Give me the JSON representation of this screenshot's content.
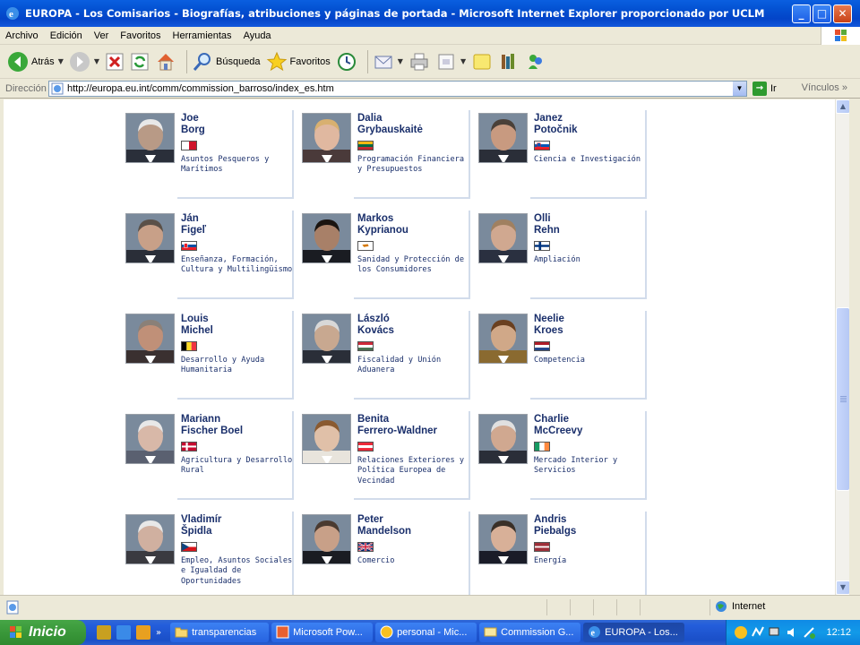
{
  "window": {
    "title": "EUROPA - Los Comisarios - Biografías, atribuciones y páginas de portada - Microsoft Internet Explorer proporcionado por UCLM",
    "minimize": "_",
    "maximize": "□",
    "close": "✕"
  },
  "menu": [
    "Archivo",
    "Edición",
    "Ver",
    "Favoritos",
    "Herramientas",
    "Ayuda"
  ],
  "toolbar": {
    "back": "Atrás",
    "search": "Búsqueda",
    "favorites": "Favoritos"
  },
  "address": {
    "label": "Dirección",
    "url": "http://europa.eu.int/comm/commission_barroso/index_es.htm",
    "go": "Ir",
    "links": "Vínculos"
  },
  "commissioners": [
    {
      "first": "Joe",
      "last": "Borg",
      "portfolio": "Asuntos Pesqueros y Marítimos",
      "flag": "malta",
      "skin": "#b89a86",
      "hair": "#e8e8e8",
      "suit": "#2a2f3a"
    },
    {
      "first": "Dalia",
      "last": "Grybauskaitė",
      "portfolio": "Programación Financiera y Presupuestos",
      "flag": "lithuania",
      "skin": "#e0b8a0",
      "hair": "#d8b070",
      "suit": "#4a3a3a"
    },
    {
      "first": "Janez",
      "last": "Potočnik",
      "portfolio": "Ciencia e Investigación",
      "flag": "slovenia",
      "skin": "#c89a80",
      "hair": "#4a4038",
      "suit": "#2a2e38"
    },
    {
      "first": "Ján",
      "last": "Figeľ",
      "portfolio": "Enseñanza, Formación, Cultura y Multilingüismo",
      "flag": "slovakia",
      "skin": "#c8a088",
      "hair": "#5a5048",
      "suit": "#2a2e38"
    },
    {
      "first": "Markos",
      "last": "Kyprianou",
      "portfolio": "Sanidad y Protección de los Consumidores",
      "flag": "cyprus",
      "skin": "#a88068",
      "hair": "#1a1410",
      "suit": "#1a1c22"
    },
    {
      "first": "Olli",
      "last": "Rehn",
      "portfolio": "Ampliación",
      "flag": "finland",
      "skin": "#d0a890",
      "hair": "#a08060",
      "suit": "#2a3040"
    },
    {
      "first": "Louis",
      "last": "Michel",
      "portfolio": "Desarrollo y Ayuda Humanitaria",
      "flag": "belgium",
      "skin": "#c09078",
      "hair": "#8a8078",
      "suit": "#3a3030"
    },
    {
      "first": "László",
      "last": "Kovács",
      "portfolio": "Fiscalidad y Unión Aduanera",
      "flag": "hungary",
      "skin": "#c8a890",
      "hair": "#d8d8d8",
      "suit": "#2a2e38"
    },
    {
      "first": "Neelie",
      "last": "Kroes",
      "portfolio": "Competencia",
      "flag": "netherlands",
      "skin": "#d0a888",
      "hair": "#6a4020",
      "suit": "#8a6a30"
    },
    {
      "first": "Mariann",
      "last": "Fischer Boel",
      "portfolio": "Agricultura y Desarrollo Rural",
      "flag": "denmark",
      "skin": "#d8b8a8",
      "hair": "#e8e8e8",
      "suit": "#5a6070"
    },
    {
      "first": "Benita",
      "last": "Ferrero-Waldner",
      "portfolio": "Relaciones Exteriores y Política Europea de Vecindad",
      "flag": "austria",
      "skin": "#e0c0a8",
      "hair": "#8a5a30",
      "suit": "#e8e4dc"
    },
    {
      "first": "Charlie",
      "last": "McCreevy",
      "portfolio": "Mercado Interior y Servicios",
      "flag": "ireland",
      "skin": "#d0a890",
      "hair": "#e0e0e0",
      "suit": "#2a2e38"
    },
    {
      "first": "Vladimír",
      "last": "Špidla",
      "portfolio": "Empleo, Asuntos Sociales e Igualdad de Oportunidades",
      "flag": "czech",
      "skin": "#d0b0a0",
      "hair": "#e8e8e8",
      "suit": "#3a3a40"
    },
    {
      "first": "Peter",
      "last": "Mandelson",
      "portfolio": "Comercio",
      "flag": "uk",
      "skin": "#c8a088",
      "hair": "#4a3a30",
      "suit": "#1a1c22"
    },
    {
      "first": "Andris",
      "last": "Piebalgs",
      "portfolio": "Energía",
      "flag": "latvia",
      "skin": "#d8b098",
      "hair": "#3a3028",
      "suit": "#1a1c28"
    }
  ],
  "status": {
    "zone": "Internet"
  },
  "taskbar": {
    "start": "Inicio",
    "tasks": [
      "transparencias",
      "Microsoft Pow...",
      "personal - Mic...",
      "Commission G...",
      "EUROPA - Los..."
    ],
    "clock": "12:12"
  }
}
